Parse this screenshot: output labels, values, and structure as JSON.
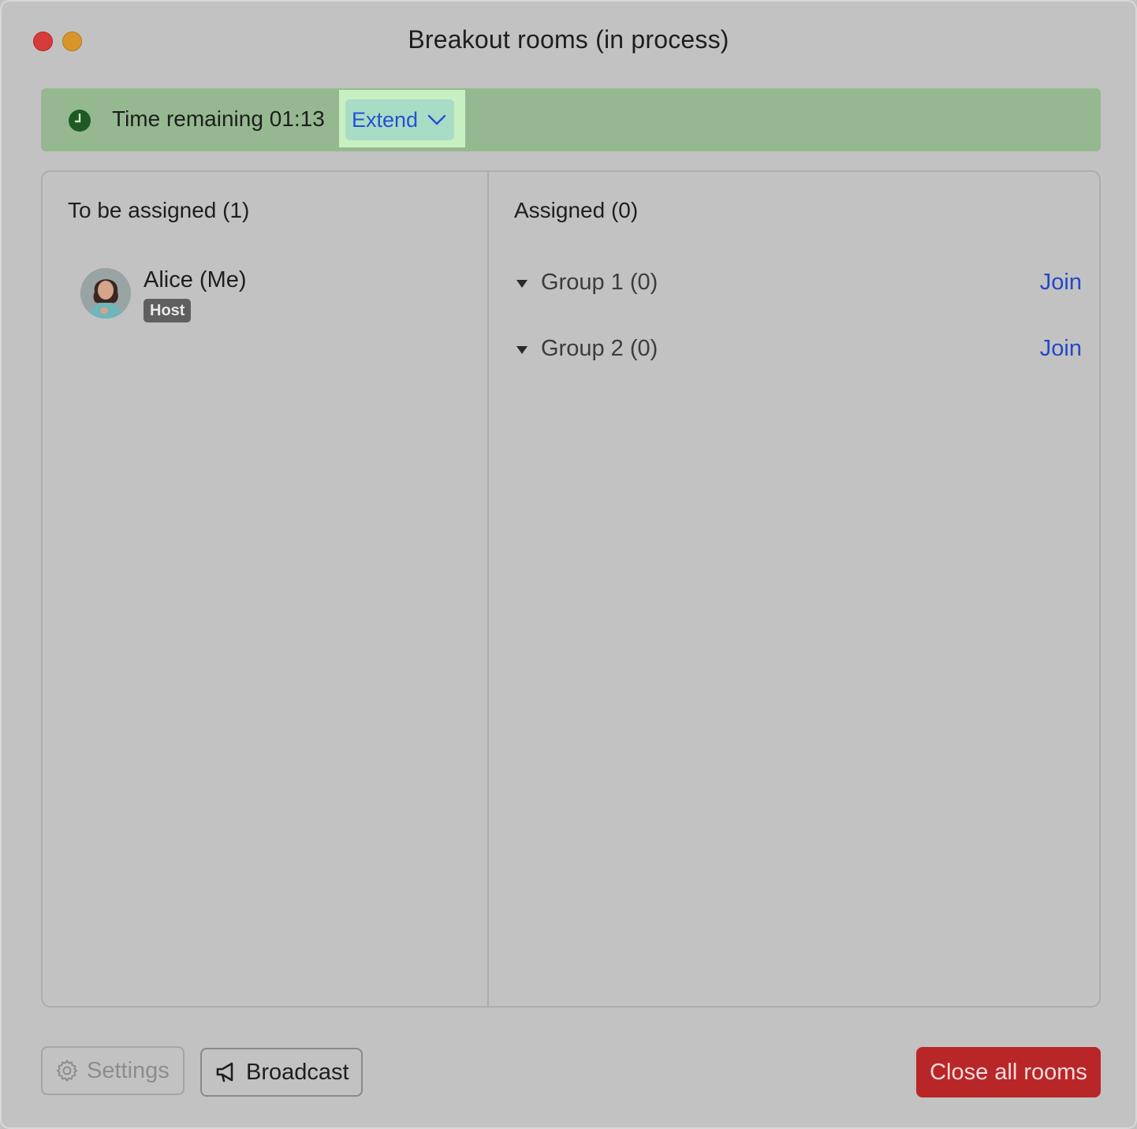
{
  "window": {
    "title": "Breakout rooms (in process)"
  },
  "timer": {
    "label": "Time remaining 01:13",
    "extend_label": "Extend"
  },
  "unassigned": {
    "heading": "To be assigned (1)",
    "people": [
      {
        "name": "Alice (Me)",
        "role": "Host"
      }
    ]
  },
  "assigned": {
    "heading": "Assigned (0)",
    "groups": [
      {
        "label": "Group 1 (0)",
        "action": "Join"
      },
      {
        "label": "Group 2 (0)",
        "action": "Join"
      }
    ]
  },
  "footer": {
    "settings_label": "Settings",
    "broadcast_label": "Broadcast",
    "close_label": "Close all rooms"
  },
  "colors": {
    "timer_bar": "#96b891",
    "link": "#2348c7",
    "danger": "#b92628"
  }
}
